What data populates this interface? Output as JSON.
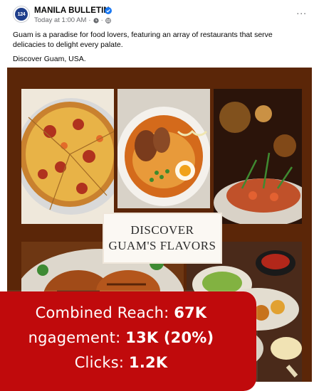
{
  "publisher": {
    "avatar_text": "124",
    "name": "MANILA BULLETIN",
    "verified_icon": "verified-badge-icon",
    "timestamp": "Today at 1:00 AM",
    "privacy_icon": "globe-icon",
    "more_label": "..."
  },
  "caption": {
    "line1": "Guam is a paradise for food lovers, featuring an array of restaurants that serve delicacies to delight every palate.",
    "line2": "Discover Guam, USA."
  },
  "image": {
    "title_line1": "DISCOVER",
    "title_line2": "GUAM'S FLAVORS",
    "background_color": "#5b2608",
    "photos": [
      "pizza",
      "ramen",
      "grilled-plate",
      "grilled-chicken",
      "appetizer-spread"
    ]
  },
  "stats": {
    "reach_label": "Combined Reach: ",
    "reach_value": "67K",
    "engagement_label": "ngagement: ",
    "engagement_value": "13K (20%)",
    "clicks_label": "Clicks: ",
    "clicks_value": "1.2K",
    "background_color": "#c00a0c"
  }
}
